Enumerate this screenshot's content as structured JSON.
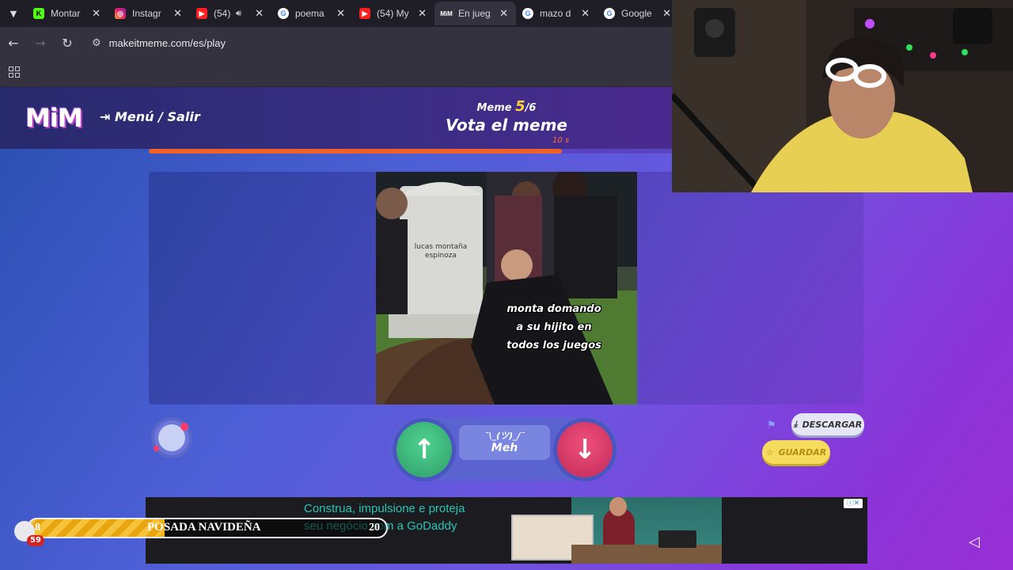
{
  "browser": {
    "tabs": [
      {
        "title": "Montar",
        "icon": "kick-icon"
      },
      {
        "title": "Instagr",
        "icon": "instagram-icon"
      },
      {
        "title": "(54)",
        "icon": "youtube-icon"
      },
      {
        "title": "poema",
        "icon": "google-icon"
      },
      {
        "title": "(54) My",
        "icon": "youtube-icon"
      },
      {
        "title": "En jueg",
        "icon": "mim-icon",
        "active": true
      },
      {
        "title": "mazo d",
        "icon": "google-icon"
      },
      {
        "title": "Google",
        "icon": "google-icon"
      }
    ],
    "url": "makeitmeme.com/es/play"
  },
  "header": {
    "logo": "MiM",
    "menu_exit": "Menú / Salir",
    "meme_label": "Meme",
    "meme_current": "5",
    "meme_total": "/6",
    "title": "Vota el meme",
    "timer": "10 s",
    "progress_fraction": 0.788
  },
  "meme": {
    "grave_text": "lucas montaña espinoza",
    "caption": "monta domando a su hijito en todos los juegos"
  },
  "vote": {
    "meh_kaomoji": "¯\\_(ツ)_/¯",
    "meh_label": "Meh"
  },
  "actions": {
    "download_label": "DESCARGAR",
    "save_label": "GUARDAR"
  },
  "ad": {
    "line1": "Construa, impulsione e proteja",
    "line2": "seu negócio com a GoDaddy"
  },
  "overlay": {
    "left_value": "8",
    "title": "POSADA NAVIDEÑA",
    "right_value": "20",
    "badge": "59"
  },
  "colors": {
    "accent_orange": "#f0612a",
    "up_green": "#3fbf7f",
    "down_pink": "#e0406c",
    "save_yellow": "#f5dc5c"
  }
}
